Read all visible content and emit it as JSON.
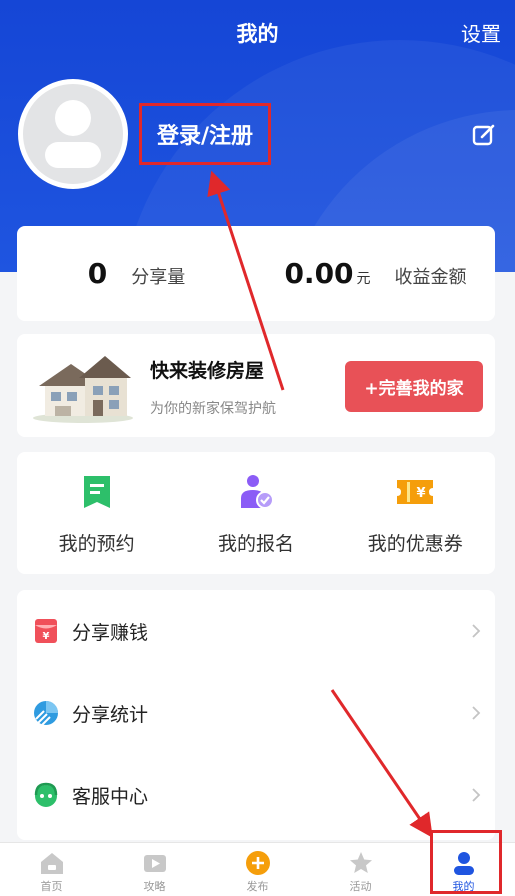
{
  "header": {
    "title": "我的",
    "settings_label": "设置",
    "login_label": "登录/注册",
    "bg_color": "#1f55e0"
  },
  "stats": {
    "share_count": "0",
    "share_label": "分享量",
    "earnings_value": "0.00",
    "earnings_unit": "元",
    "earnings_label": "收益金额"
  },
  "promo": {
    "title": "快来装修房屋",
    "subtitle": "为你的新家保驾护航",
    "button_label": "+完善我的家",
    "button_color": "#e85157"
  },
  "quick_actions": [
    {
      "label": "我的预约",
      "icon": "bookmark-icon",
      "color": "#2dbf6a"
    },
    {
      "label": "我的报名",
      "icon": "user-check-icon",
      "color": "#8b5cf6"
    },
    {
      "label": "我的优惠券",
      "icon": "coupon-icon",
      "color": "#f59e0b"
    }
  ],
  "menu": [
    {
      "label": "分享赚钱",
      "icon": "red-envelope-icon"
    },
    {
      "label": "分享统计",
      "icon": "pie-chart-icon"
    },
    {
      "label": "客服中心",
      "icon": "headset-icon"
    }
  ],
  "tabbar": [
    {
      "label": "首页",
      "icon": "home-icon",
      "active": false
    },
    {
      "label": "攻略",
      "icon": "video-icon",
      "active": false
    },
    {
      "label": "发布",
      "icon": "plus-circle-icon",
      "active": false
    },
    {
      "label": "活动",
      "icon": "star-icon",
      "active": false
    },
    {
      "label": "我的",
      "icon": "user-icon",
      "active": true
    }
  ],
  "annotation_color": "#e0282b"
}
